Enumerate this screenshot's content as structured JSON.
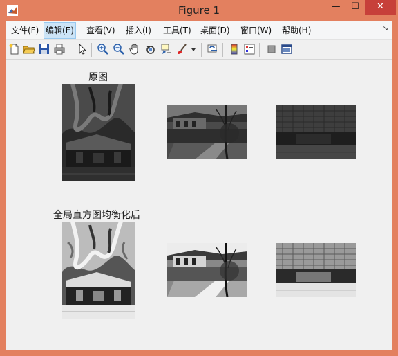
{
  "window": {
    "title": "Figure 1"
  },
  "menus": [
    {
      "label": "文件(F)",
      "name": "menu-file"
    },
    {
      "label": "编辑(E)",
      "name": "menu-edit",
      "active": true
    },
    {
      "label": "查看(V)",
      "name": "menu-view"
    },
    {
      "label": "插入(I)",
      "name": "menu-insert"
    },
    {
      "label": "工具(T)",
      "name": "menu-tools"
    },
    {
      "label": "桌面(D)",
      "name": "menu-desktop"
    },
    {
      "label": "窗口(W)",
      "name": "menu-window"
    },
    {
      "label": "帮助(H)",
      "name": "menu-help"
    }
  ],
  "toolbar_icons": [
    "new-figure-icon",
    "open-file-icon",
    "save-icon",
    "print-icon",
    "select-pointer-icon",
    "zoom-in-icon",
    "zoom-out-icon",
    "pan-hand-icon",
    "rotate-3d-icon",
    "data-cursor-icon",
    "brush-icon",
    "link-plot-icon",
    "colorbar-icon",
    "legend-icon",
    "hide-plot-tools-icon",
    "show-plot-tools-icon"
  ],
  "figure": {
    "top_label": "原图",
    "bottom_label": "全局直方图均衡化后"
  },
  "colors": {
    "titlebar": "#e3805f",
    "close": "#c7403a",
    "menu_active": "#cce4f7"
  }
}
